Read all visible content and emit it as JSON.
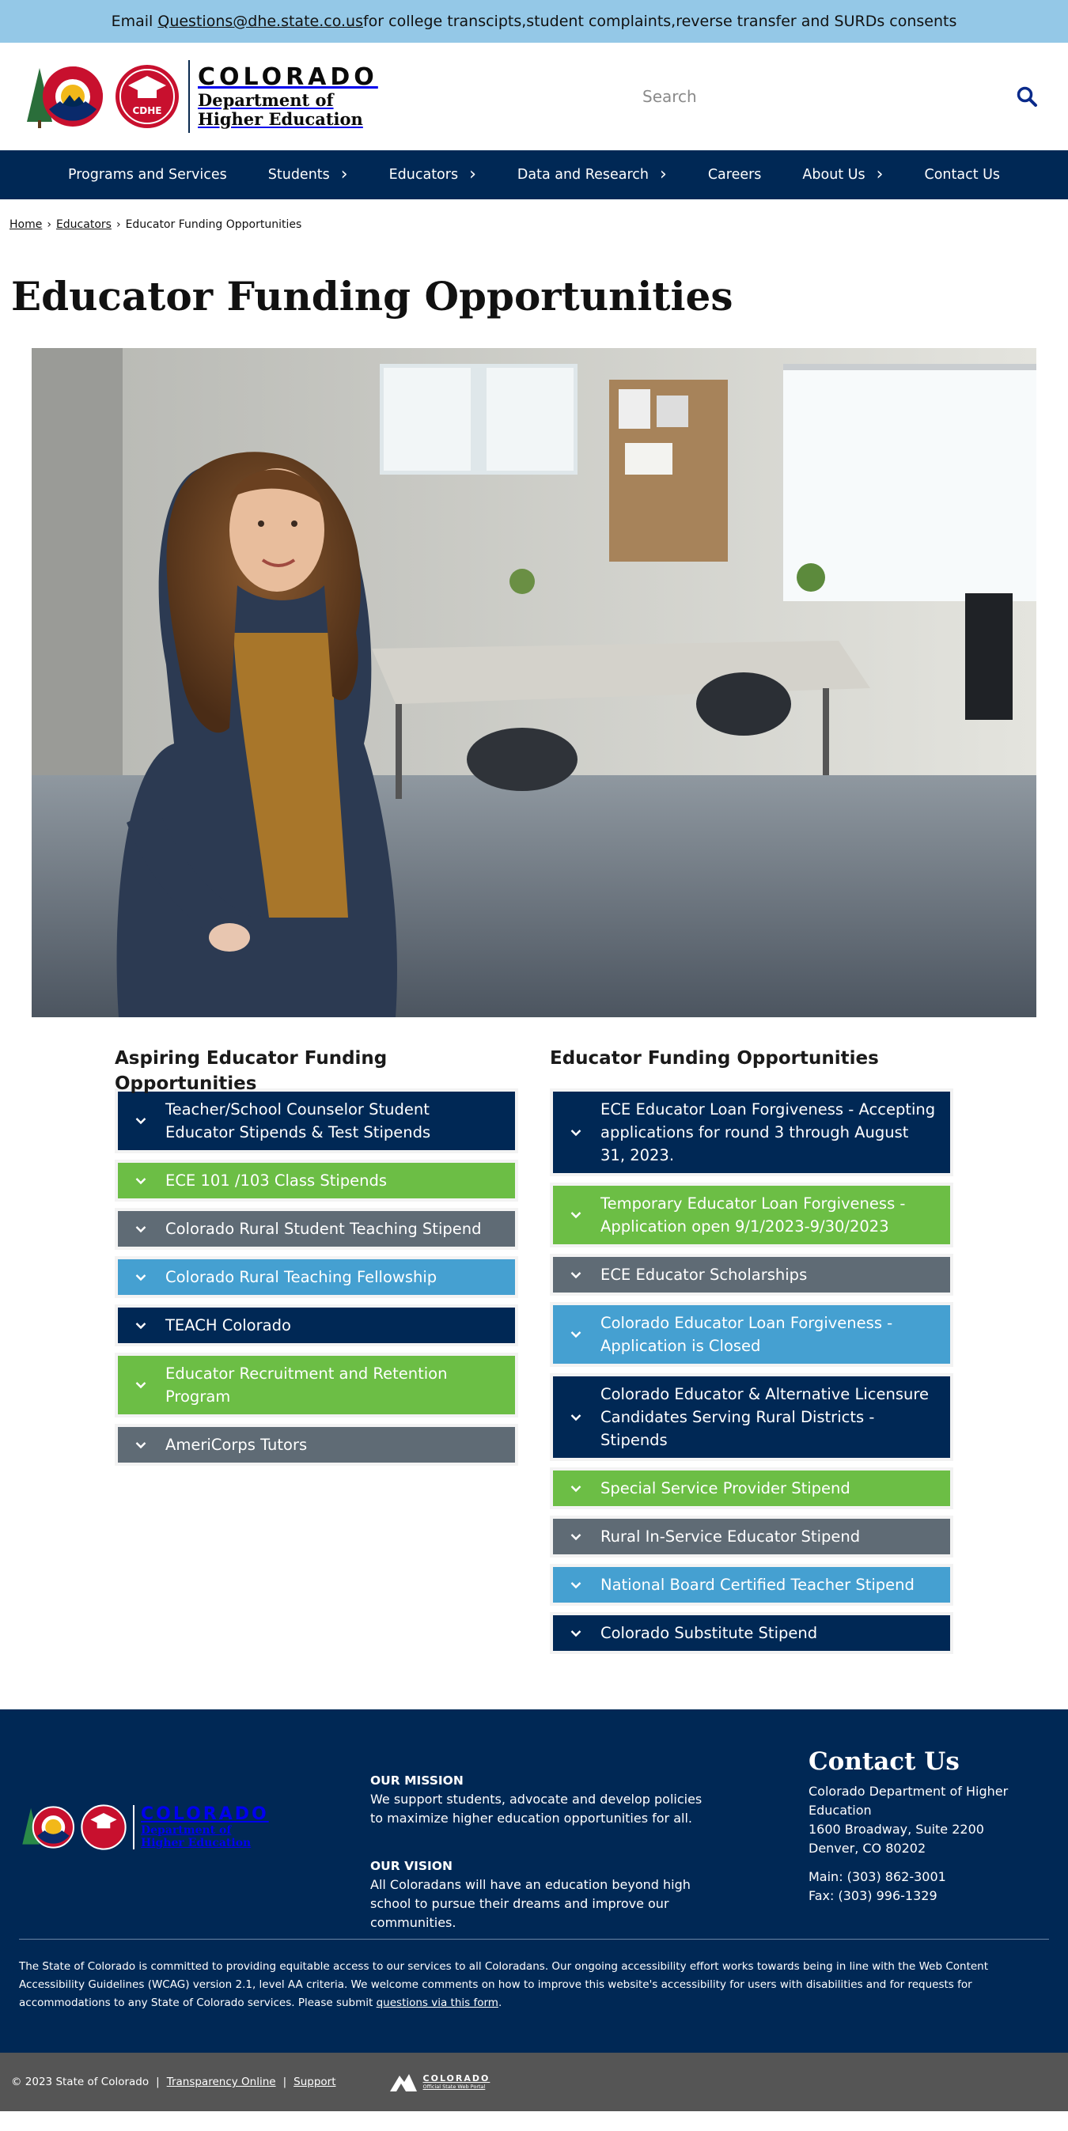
{
  "alert": {
    "prefix": "Email ",
    "email": "Questions@dhe.state.co.us",
    "suffix": " for college transcipts,student complaints,reverse transfer and SURDs consents"
  },
  "header": {
    "logo_title": "COLORADO",
    "logo_line1": "Department of",
    "logo_line2": "Higher Education",
    "logo_badge": "CDHE",
    "search_placeholder": "Search"
  },
  "nav": {
    "items": [
      {
        "label": "Programs and Services",
        "has_children": false
      },
      {
        "label": "Students",
        "has_children": true
      },
      {
        "label": "Educators",
        "has_children": true
      },
      {
        "label": "Data and Research",
        "has_children": true
      },
      {
        "label": "Careers",
        "has_children": false
      },
      {
        "label": "About Us",
        "has_children": true
      },
      {
        "label": "Contact Us",
        "has_children": false
      }
    ]
  },
  "breadcrumb": {
    "home": "Home",
    "educators": "Educators",
    "current": "Educator Funding Opportunities",
    "separator": "›"
  },
  "page_title": "Educator Funding Opportunities",
  "columns": {
    "left": {
      "title": "Aspiring Educator Funding Opportunities",
      "items": [
        {
          "label": "Teacher/School Counselor Student Educator Stipends & Test Stipends",
          "color": "#002855"
        },
        {
          "label": "ECE 101 /103 Class Stipends",
          "color": "#6cbe45"
        },
        {
          "label": "Colorado Rural Student Teaching Stipend",
          "color": "#5f6b75"
        },
        {
          "label": "Colorado Rural Teaching Fellowship",
          "color": "#45a0d1"
        },
        {
          "label": "TEACH Colorado",
          "color": "#002855"
        },
        {
          "label": "Educator Recruitment and Retention Program",
          "color": "#6cbe45"
        },
        {
          "label": "AmeriCorps Tutors",
          "color": "#5f6b75"
        }
      ]
    },
    "right": {
      "title": "Educator Funding Opportunities",
      "items": [
        {
          "label": "ECE Educator Loan Forgiveness - Accepting applications for round 3 through August 31, 2023.",
          "color": "#002855"
        },
        {
          "label": "Temporary Educator Loan Forgiveness - Application open 9/1/2023-9/30/2023",
          "color": "#6cbe45"
        },
        {
          "label": "ECE Educator Scholarships",
          "color": "#5f6b75"
        },
        {
          "label": "Colorado Educator Loan Forgiveness - Application is Closed",
          "color": "#45a0d1"
        },
        {
          "label": "Colorado Educator & Alternative Licensure Candidates Serving Rural Districts - Stipends",
          "color": "#002855"
        },
        {
          "label": "Special Service Provider Stipend",
          "color": "#6cbe45"
        },
        {
          "label": "Rural In-Service Educator Stipend",
          "color": "#5f6b75"
        },
        {
          "label": "National Board Certified Teacher Stipend",
          "color": "#45a0d1"
        },
        {
          "label": "Colorado Substitute Stipend",
          "color": "#002855"
        }
      ]
    }
  },
  "footer": {
    "logo_title": "COLORADO",
    "logo_line1": "Department of",
    "logo_line2": "Higher Education",
    "mission_heading": "OUR MISSION",
    "mission_text": "We support students, advocate and develop policies to maximize higher education opportunities for all.",
    "vision_heading": "OUR VISION",
    "vision_text": "All Coloradans will have an education beyond high school to pursue their dreams and improve our communities.",
    "contact_heading": "Contact Us",
    "contact_org": "Colorado Department of Higher Education",
    "contact_street": "1600 Broadway, Suite 2200",
    "contact_city": "Denver, CO 80202",
    "contact_main": "Main: (303) 862-3001",
    "contact_fax": "Fax: (303) 996-1329",
    "accessibility_text": "The State of Colorado is committed to providing equitable access to our services to all Coloradans. Our ongoing accessibility effort works towards being in line with the Web Content Accessibility Guidelines (WCAG) version 2.1, level AA criteria. We welcome comments on how to improve this website's accessibility for users with disabilities and for requests for accommodations to any State of Colorado services. Please submit ",
    "accessibility_link": "questions via this form",
    "accessibility_end": "."
  },
  "bottom_bar": {
    "copyright": "© 2023 State of Colorado",
    "link1": "Transparency Online",
    "link2": "Support",
    "portal_title": "COLORADO",
    "portal_sub": "Official State Web Portal"
  },
  "colors": {
    "navy": "#002855",
    "green": "#6cbe45",
    "gray": "#5f6b75",
    "blue": "#45a0d1",
    "alert_bg": "#94c8e7"
  }
}
